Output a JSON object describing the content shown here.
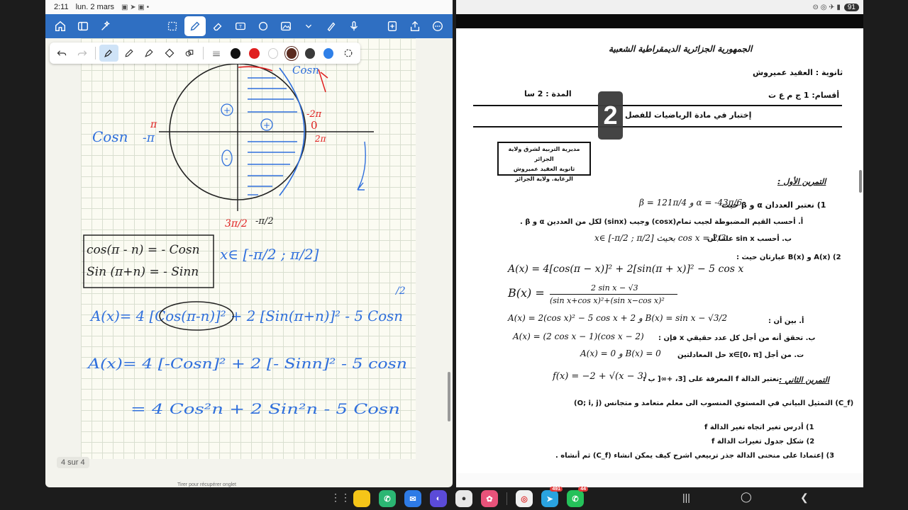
{
  "status_left": {
    "time": "2:11",
    "date": "lun. 2 mars"
  },
  "status_right": {
    "battery": "91"
  },
  "app_toolbar": {
    "left_icons": [
      "home-icon",
      "sidebar-icon",
      "magic-icon"
    ],
    "center_icons": [
      "lasso-icon",
      "pen-icon",
      "eraser-icon",
      "textbox-icon",
      "shapes-icon",
      "image-icon",
      "chevron-down-icon",
      "highlighter-icon",
      "mic-icon"
    ],
    "right_icons": [
      "add-page-icon",
      "share-icon",
      "more-icon"
    ]
  },
  "pen_toolbar": {
    "colors": [
      "#111111",
      "#e01f1f",
      "#ffffff",
      "#5a2a1e",
      "#3a3a3a",
      "#2f80e8"
    ]
  },
  "note": {
    "page_counter": "4 sur 4",
    "annotations": {
      "cosn": "Cosn",
      "minus_pi": "-π",
      "pi": "π",
      "neg_2pi": "-2π",
      "zero": "0",
      "two_pi": "2π",
      "plus_top": "+",
      "plus_right": "+",
      "minus_left": "-",
      "three_pi_half": "3π/2",
      "minus_pi_half": "-π/2",
      "boxed_line1": "cos(π - n) = - Cosn",
      "boxed_line2": "Sin (π+n) = - Sinn",
      "interval": "x∈ [-π/2 ; π/2]",
      "line_a1": "A(x)= 4 [Cos(π-n)]² + 2 [Sin(π+n)]² - 5 Cosn",
      "line_a2": "A(x)= 4 [-Cosn]² + 2 [- Sinn]² - 5 cosn",
      "line_a3": "= 4 Cos²n + 2 Sin²n - 5 Cosn",
      "half_mark": "/2"
    }
  },
  "document": {
    "republic": "الجمهورية الجزائرية الديمقراطية الشعبية",
    "school": "ثانوية : العقيد عميروش",
    "class": "أقسام: 1 ج م ع ت",
    "duration": "المدة : 2 سا",
    "exam_title": "إختبار في مادة الرياضيات للفصل",
    "stamp_line1": "مديرية التربية لشرق ولاية الجزائر",
    "stamp_line2": "ثانوية العقيد عميروش",
    "stamp_line3": "الرغاية. ولاية الجزائر",
    "ex1_title": "التمرين الأول :",
    "ex1_q1": "1) نعتبر العددان α و β حيث",
    "ex1_q1_formula": "β = 121π/4  و  α = -43π/6",
    "ex1_q1a": "أ.  أحسب القيم المضبوطة لجيب تمام(cosx) وجيب (sinx) لكل من العددين α و β .",
    "ex1_q1b": "ب. أحسب sin x علما أن",
    "ex1_q1b_formula": "x∈ [-π/2 ; π/2]  بحيث  cos x = 2/3",
    "ex1_q2": "2) A(x) و B(x) عبارتان حيث :",
    "formula_A": "A(x) = 4[cos(π − x)]² + 2[sin(π + x)]² − 5 cos x",
    "formula_B_num": "2 sin x − √3",
    "formula_B_den": "(sin x+cos x)²+(sin x−cos x)²",
    "formula_B_label": "B(x) =",
    "ex1_a": "أ.  بين أن :",
    "ex1_a_formula": "A(x) = 2(cos x)² − 5 cos x + 2   و   B(x) = sin x − √3/2",
    "ex1_b": "ب. تحقق أنه من أجل كل عدد حقيقي x فإن :",
    "ex1_b_formula": "A(x) = (2 cos x − 1)(cos x − 2)",
    "ex1_c": "ت. من أجل x∈[0، π] حل المعادلتين",
    "ex1_c_formula": "A(x) = 0 و B(x) = 0",
    "ex2_title": "التمرين الثاني :",
    "ex2_text": "نعتبر الدالة f المعرفة على [3، +∞[ ب :",
    "ex2_formula": "f(x) = −2 + √(x − 3)",
    "ex2_curve": "(C_f) التمثيل البياني في المستوي المنسوب الى معلم متعامد و متجانس (O; i, j)",
    "ex2_q1": "1) أدرس تغير اتجاه تغير الدالة f",
    "ex2_q2": "2) شكل جدول تغيرات الدالة f",
    "ex2_q3": "3) إعتمادا على منحنى الدالة جذر تربيعي اشرح كيف يمكن انشاء (C_f) ثم أنشاه .",
    "badge": "2"
  },
  "bottom_hint": "Tirer pour récupérer onglet",
  "dock": {
    "apps": [
      {
        "name": "notes-app",
        "color": "#f5c518",
        "label": ""
      },
      {
        "name": "phone-app",
        "color": "#2bb673",
        "label": ""
      },
      {
        "name": "messages-app",
        "color": "#2e7be6",
        "label": ""
      },
      {
        "name": "browser-app",
        "color": "#5b4bd8",
        "label": ""
      },
      {
        "name": "camera-app",
        "color": "#e8e8e8",
        "label": ""
      },
      {
        "name": "gallery-app",
        "color": "#e9527a",
        "label": ""
      },
      {
        "name": "multi-app",
        "color": "#f0f0f0",
        "label": ""
      },
      {
        "name": "telegram-app",
        "color": "#2aa3e0",
        "label": "",
        "badge": "491"
      },
      {
        "name": "whatsapp-app",
        "color": "#25c15a",
        "label": "",
        "badge": "44"
      }
    ]
  }
}
